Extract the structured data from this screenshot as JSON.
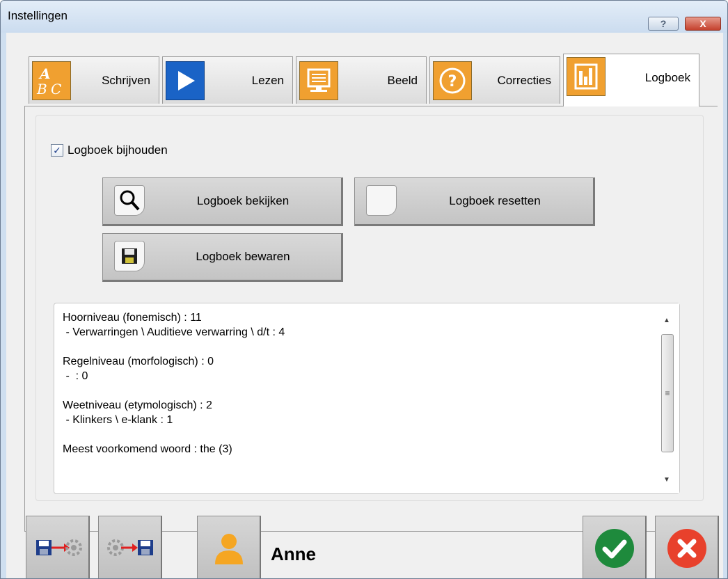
{
  "window": {
    "title": "Instellingen",
    "help_button": "?",
    "close_button": "X"
  },
  "tabs": [
    {
      "label": "Schrijven",
      "icon": "abc-icon",
      "color": "#f0a030"
    },
    {
      "label": "Lezen",
      "icon": "play-icon",
      "color": "#1a63c6"
    },
    {
      "label": "Beeld",
      "icon": "monitor-icon",
      "color": "#f0a030"
    },
    {
      "label": "Correcties",
      "icon": "question-icon",
      "color": "#f0a030"
    },
    {
      "label": "Logboek",
      "icon": "bar-chart-icon",
      "color": "#f0a030",
      "active": true
    }
  ],
  "logbook": {
    "keep_log_label": "Logboek bijhouden",
    "keep_log_checked": true,
    "view_button": "Logboek bekijken",
    "reset_button": "Logboek resetten",
    "save_button": "Logboek bewaren",
    "lines": [
      "Hoorniveau (fonemisch) : 11",
      " - Verwarringen \\ Auditieve verwarring \\ d/t : 4",
      "",
      "Regelniveau (morfologisch) : 0",
      " -  : 0",
      "",
      "Weetniveau (etymologisch) : 2",
      " - Klinkers \\ e-klank : 1",
      "",
      "Meest voorkomend woord : the (3)"
    ]
  },
  "footer": {
    "export_icon": "export-settings-icon",
    "import_icon": "import-settings-icon",
    "user_icon": "user-icon",
    "user_name": "Anne",
    "ok_icon": "check-icon",
    "cancel_icon": "cancel-icon",
    "ok_color": "#1e8a3c",
    "cancel_color": "#e8412c"
  }
}
